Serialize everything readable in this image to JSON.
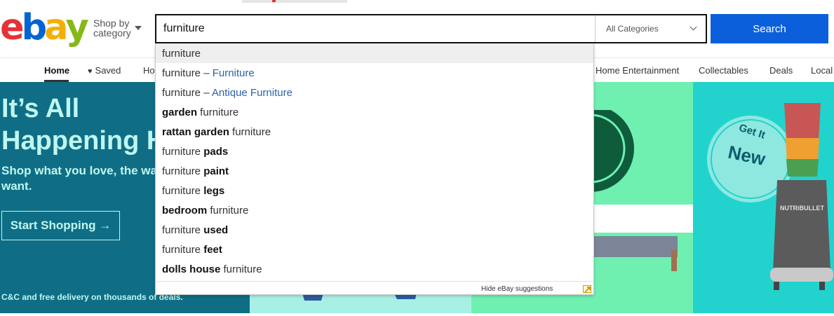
{
  "header": {
    "logo_letters": [
      {
        "char": "e",
        "color": "#e53238"
      },
      {
        "char": "b",
        "color": "#0064d2"
      },
      {
        "char": "a",
        "color": "#f5af02"
      },
      {
        "char": "y",
        "color": "#86b817"
      }
    ],
    "shop_by_category": "Shop by\ncategory",
    "search": {
      "value": "furniture",
      "category": "All Categories",
      "button_label": "Search"
    }
  },
  "nav": {
    "items": [
      {
        "label": "Home",
        "active": true
      },
      {
        "label": "Saved",
        "icon": "heart-icon"
      },
      {
        "label": "Ho"
      },
      {
        "label": "Home Entertainment"
      },
      {
        "label": "Collectables"
      },
      {
        "label": "Deals"
      },
      {
        "label": "Local"
      }
    ]
  },
  "hero": {
    "title": "It’s All\nHappening H",
    "subtitle": "Shop what you love, the wa\nwant.",
    "button_label": "Start Shopping →",
    "footnote": "C&C and free delivery on thousands of deals.",
    "badge_text": [
      "Get It",
      "New"
    ],
    "product_brand": "NUTRiBULLET",
    "badge_partial": "e"
  },
  "suggestions": {
    "items": [
      {
        "parts": [
          {
            "t": "furniture",
            "s": "n"
          }
        ],
        "highlighted": true
      },
      {
        "parts": [
          {
            "t": "furniture – ",
            "s": "n"
          },
          {
            "t": "Furniture",
            "s": "c"
          }
        ]
      },
      {
        "parts": [
          {
            "t": "furniture – ",
            "s": "n"
          },
          {
            "t": "Antique Furniture",
            "s": "c"
          }
        ]
      },
      {
        "parts": [
          {
            "t": "garden",
            "s": "b"
          },
          {
            "t": " furniture",
            "s": "n"
          }
        ]
      },
      {
        "parts": [
          {
            "t": "rattan garden",
            "s": "b"
          },
          {
            "t": " furniture",
            "s": "n"
          }
        ]
      },
      {
        "parts": [
          {
            "t": "furniture ",
            "s": "n"
          },
          {
            "t": "pads",
            "s": "b"
          }
        ]
      },
      {
        "parts": [
          {
            "t": "furniture ",
            "s": "n"
          },
          {
            "t": "paint",
            "s": "b"
          }
        ]
      },
      {
        "parts": [
          {
            "t": "furniture ",
            "s": "n"
          },
          {
            "t": "legs",
            "s": "b"
          }
        ]
      },
      {
        "parts": [
          {
            "t": "bedroom",
            "s": "b"
          },
          {
            "t": " furniture",
            "s": "n"
          }
        ]
      },
      {
        "parts": [
          {
            "t": "furniture ",
            "s": "n"
          },
          {
            "t": "used",
            "s": "b"
          }
        ]
      },
      {
        "parts": [
          {
            "t": "furniture ",
            "s": "n"
          },
          {
            "t": "feet",
            "s": "b"
          }
        ]
      },
      {
        "parts": [
          {
            "t": "dolls house",
            "s": "b"
          },
          {
            "t": " furniture",
            "s": "n"
          }
        ]
      }
    ],
    "hide_label": "Hide eBay suggestions"
  },
  "colors": {
    "accent": "#0b5fdb",
    "hero_left": "#0f6e85",
    "hero_mid": "#a8efe6",
    "hero_green": "#6ff0b0",
    "hero_teal": "#22d3cd",
    "link": "#2b63a8"
  }
}
